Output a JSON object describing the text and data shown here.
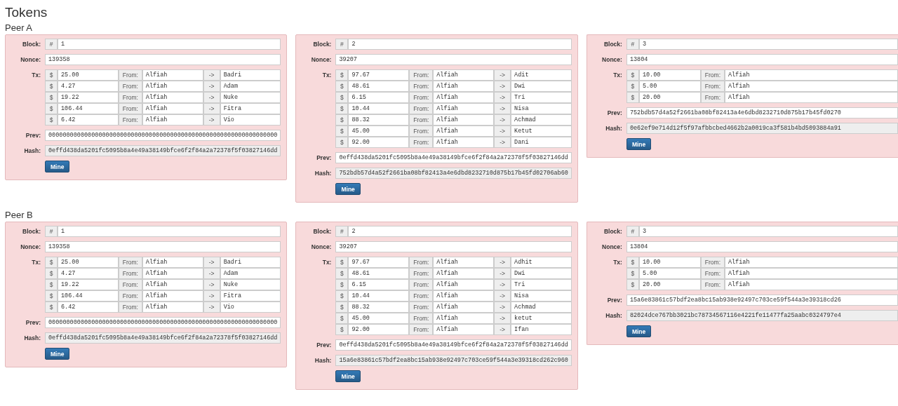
{
  "title": "Tokens",
  "peers": [
    {
      "name": "Peer A",
      "blocks": [
        {
          "block_label": "Block:",
          "hash_sign": "#",
          "number": "1",
          "nonce_label": "Nonce:",
          "nonce": "139358",
          "tx_label": "Tx:",
          "txs": [
            {
              "currency": "$",
              "amount": "25.00",
              "from_label": "From:",
              "from": "Alfiah",
              "arrow": "->",
              "to": "Badri"
            },
            {
              "currency": "$",
              "amount": "4.27",
              "from_label": "From:",
              "from": "Alfiah",
              "arrow": "->",
              "to": "Adam"
            },
            {
              "currency": "$",
              "amount": "19.22",
              "from_label": "From:",
              "from": "Alfiah",
              "arrow": "->",
              "to": "Nuke"
            },
            {
              "currency": "$",
              "amount": "106.44",
              "from_label": "From:",
              "from": "Alfiah",
              "arrow": "->",
              "to": "Fitra"
            },
            {
              "currency": "$",
              "amount": "6.42",
              "from_label": "From:",
              "from": "Alfiah",
              "arrow": "->",
              "to": "Vio"
            }
          ],
          "prev_label": "Prev:",
          "prev": "0000000000000000000000000000000000000000000000000000000000000000",
          "hash_label": "Hash:",
          "hash": "0effd438da5201fc5095b8a4e49a38149bfce6f2f84a2a72378f5f03827146dd",
          "mine_button": "Mine"
        },
        {
          "block_label": "Block:",
          "hash_sign": "#",
          "number": "2",
          "nonce_label": "Nonce:",
          "nonce": "39207",
          "tx_label": "Tx:",
          "txs": [
            {
              "currency": "$",
              "amount": "97.67",
              "from_label": "From:",
              "from": "Alfiah",
              "arrow": "->",
              "to": "Adit"
            },
            {
              "currency": "$",
              "amount": "48.61",
              "from_label": "From:",
              "from": "Alfiah",
              "arrow": "->",
              "to": "Dwi"
            },
            {
              "currency": "$",
              "amount": "6.15",
              "from_label": "From:",
              "from": "Alfiah",
              "arrow": "->",
              "to": "Tri"
            },
            {
              "currency": "$",
              "amount": "10.44",
              "from_label": "From:",
              "from": "Alfiah",
              "arrow": "->",
              "to": "Nisa"
            },
            {
              "currency": "$",
              "amount": "88.32",
              "from_label": "From:",
              "from": "Alfiah",
              "arrow": "->",
              "to": "Achmad"
            },
            {
              "currency": "$",
              "amount": "45.00",
              "from_label": "From:",
              "from": "Alfiah",
              "arrow": "->",
              "to": "Ketut"
            },
            {
              "currency": "$",
              "amount": "92.00",
              "from_label": "From:",
              "from": "Alfiah",
              "arrow": "->",
              "to": "Dani"
            }
          ],
          "prev_label": "Prev:",
          "prev": "0effd438da5201fc5095b8a4e49a38149bfce6f2f84a2a72378f5f03827146dd",
          "hash_label": "Hash:",
          "hash": "752bdb57d4a52f2661ba08bf82413a4e6dbd8232710d875b17b45fd02706ab60",
          "mine_button": "Mine"
        },
        {
          "block_label": "Block:",
          "hash_sign": "#",
          "number": "3",
          "nonce_label": "Nonce:",
          "nonce": "13804",
          "tx_label": "Tx:",
          "txs": [
            {
              "currency": "$",
              "amount": "10.00",
              "from_label": "From:",
              "from": "Alfiah"
            },
            {
              "currency": "$",
              "amount": "5.00",
              "from_label": "From:",
              "from": "Alfiah"
            },
            {
              "currency": "$",
              "amount": "20.00",
              "from_label": "From:",
              "from": "Alfiah"
            }
          ],
          "prev_label": "Prev:",
          "prev": "752bdb57d4a52f2661ba08bf82413a4e6dbd8232710d875b17b45fd0270",
          "hash_label": "Hash:",
          "hash": "0e62ef9e714d12f5f97afbbcbed4662b2a0019ca3f581b4bd5093884a91",
          "mine_button": "Mine"
        }
      ]
    },
    {
      "name": "Peer B",
      "blocks": [
        {
          "block_label": "Block:",
          "hash_sign": "#",
          "number": "1",
          "nonce_label": "Nonce:",
          "nonce": "139358",
          "tx_label": "Tx:",
          "txs": [
            {
              "currency": "$",
              "amount": "25.00",
              "from_label": "From:",
              "from": "Alfiah",
              "arrow": "->",
              "to": "Badri"
            },
            {
              "currency": "$",
              "amount": "4.27",
              "from_label": "From:",
              "from": "Alfiah",
              "arrow": "->",
              "to": "Adam"
            },
            {
              "currency": "$",
              "amount": "19.22",
              "from_label": "From:",
              "from": "Alfiah",
              "arrow": "->",
              "to": "Nuke"
            },
            {
              "currency": "$",
              "amount": "106.44",
              "from_label": "From:",
              "from": "Alfiah",
              "arrow": "->",
              "to": "Fitra"
            },
            {
              "currency": "$",
              "amount": "6.42",
              "from_label": "From:",
              "from": "Alfiah",
              "arrow": "->",
              "to": "Vio"
            }
          ],
          "prev_label": "Prev:",
          "prev": "0000000000000000000000000000000000000000000000000000000000000000",
          "hash_label": "Hash:",
          "hash": "0effd438da5201fc5095b8a4e49a38149bfce6f2f84a2a72378f5f03827146dd",
          "mine_button": "Mine"
        },
        {
          "block_label": "Block:",
          "hash_sign": "#",
          "number": "2",
          "nonce_label": "Nonce:",
          "nonce": "39207",
          "tx_label": "Tx:",
          "txs": [
            {
              "currency": "$",
              "amount": "97.67",
              "from_label": "From:",
              "from": "Alfiah",
              "arrow": "->",
              "to": "Adhit"
            },
            {
              "currency": "$",
              "amount": "48.61",
              "from_label": "From:",
              "from": "Alfiah",
              "arrow": "->",
              "to": "Dwi"
            },
            {
              "currency": "$",
              "amount": "6.15",
              "from_label": "From:",
              "from": "Alfiah",
              "arrow": "->",
              "to": "Tri"
            },
            {
              "currency": "$",
              "amount": "10.44",
              "from_label": "From:",
              "from": "Alfiah",
              "arrow": "->",
              "to": "Nisa"
            },
            {
              "currency": "$",
              "amount": "88.32",
              "from_label": "From:",
              "from": "Alfiah",
              "arrow": "->",
              "to": "Achmad"
            },
            {
              "currency": "$",
              "amount": "45.00",
              "from_label": "From:",
              "from": "Alfiah",
              "arrow": "->",
              "to": "ketut"
            },
            {
              "currency": "$",
              "amount": "92.00",
              "from_label": "From:",
              "from": "Alfiah",
              "arrow": "->",
              "to": "Ifan"
            }
          ],
          "prev_label": "Prev:",
          "prev": "0effd438da5201fc5095b8a4e49a38149bfce6f2f84a2a72378f5f03827146dd",
          "hash_label": "Hash:",
          "hash": "15a6e83861c57bdf2ea8bc15ab938e92497c703ce59f544a3e39318cd262c960",
          "mine_button": "Mine"
        },
        {
          "block_label": "Block:",
          "hash_sign": "#",
          "number": "3",
          "nonce_label": "Nonce:",
          "nonce": "13804",
          "tx_label": "Tx:",
          "txs": [
            {
              "currency": "$",
              "amount": "10.00",
              "from_label": "From:",
              "from": "Alfiah"
            },
            {
              "currency": "$",
              "amount": "5.00",
              "from_label": "From:",
              "from": "Alfiah"
            },
            {
              "currency": "$",
              "amount": "20.00",
              "from_label": "From:",
              "from": "Alfiah"
            }
          ],
          "prev_label": "Prev:",
          "prev": "15a6e83861c57bdf2ea8bc15ab938e92497c703ce59f544a3e39318cd26",
          "hash_label": "Hash:",
          "hash": "82024dce767bb3021bc78734567116e4221fe11477fa25aabc0324797e4",
          "mine_button": "Mine"
        }
      ]
    }
  ]
}
